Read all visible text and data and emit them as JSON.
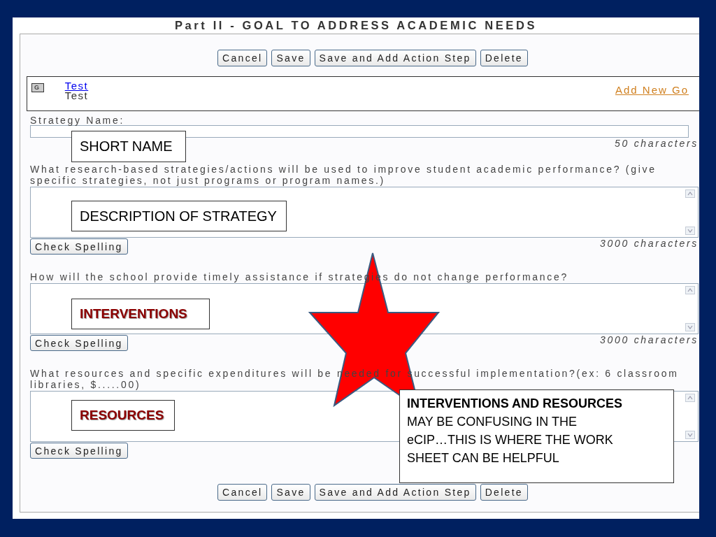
{
  "title": "Part II - GOAL TO ADDRESS ACADEMIC NEEDS",
  "top_buttons": [
    "Cancel",
    "Save",
    "Save and Add Action Step",
    "Delete"
  ],
  "goal": {
    "badge": "G",
    "link": "Test",
    "text": "Test",
    "add_link": "Add New Go"
  },
  "strategy_name": {
    "label": "Strategy Name:",
    "limit": "50 characters"
  },
  "questions": [
    {
      "prompt": "What research-based strategies/actions will be used to improve student academic performance? (give specific strategies, not just programs or program names.)",
      "spell_button": "Check Spelling",
      "limit": "3000 characters"
    },
    {
      "prompt": "How will the school provide timely assistance if strategies do not change performance?",
      "spell_button": "Check Spelling",
      "limit": "3000 characters"
    },
    {
      "prompt": "What resources and specific expenditures will be needed for successful implementation?(ex: 6 classroom libraries, $.....00)",
      "spell_button": "Check Spelling"
    }
  ],
  "bottom_buttons": [
    "Cancel",
    "Save",
    "Save and Add Action Step",
    "Delete"
  ],
  "annotations": [
    {
      "text": "SHORT NAME",
      "kind": "plain"
    },
    {
      "text": "DESCRIPTION OF STRATEGY",
      "kind": "plain"
    },
    {
      "text": "INTERVENTIONS",
      "kind": "emphasis"
    },
    {
      "text": "RESOURCES",
      "kind": "emphasis"
    }
  ],
  "callout": {
    "text": "**INTERVENTIONS AND RESOURCES**\nMAY BE CONFUSING IN THE\neCIP…THIS IS WHERE THE WORK\nSHEET CAN BE HELPFUL"
  }
}
